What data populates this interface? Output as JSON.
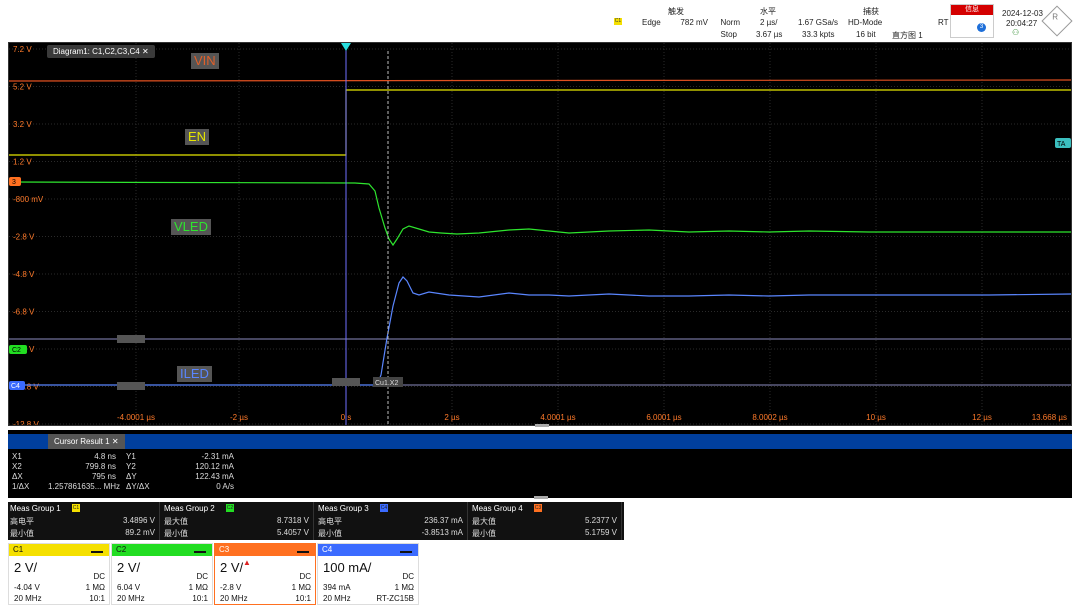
{
  "topbar": {
    "trigger": {
      "title": "触发",
      "chip": "C1",
      "type": "Edge",
      "level": "782 mV",
      "mode": "Norm",
      "state": "Stop"
    },
    "horizontal": {
      "title": "水平",
      "scale": "2 µs/",
      "position": "3.67 µs"
    },
    "acquisition": {
      "title": "捕获",
      "rate": "1.67 GSa/s",
      "points": "33.3 kpts",
      "mode": "HD-Mode",
      "bits": "16 bit",
      "histogram": "直方图 1",
      "rt": "RT"
    },
    "message": {
      "label": "信息",
      "count": "3"
    },
    "date": "2024-12-03",
    "time": "20:04:27"
  },
  "diagram": {
    "tab_label": "Diagram1: C1,C2,C3,C4",
    "labels": {
      "vin": "VIN",
      "en": "EN",
      "vled": "VLED",
      "iled": "ILED"
    },
    "y_ticks": [
      "7.2 V",
      "5.2 V",
      "3.2 V",
      "1.2 V",
      "-800 mV",
      "-2.8 V",
      "-4.8 V",
      "-6.8 V",
      "-8.8 V",
      "-10.8 V",
      "-12.8 V"
    ],
    "x_ticks": [
      "-4.0001 µs",
      "-2 µs",
      "0 s",
      "2 µs",
      "4.0001 µs",
      "6.0001 µs",
      "8.0002 µs",
      "10 µs",
      "12 µs",
      "13.668 µs"
    ],
    "marker_labels": {
      "c3": "3",
      "c2": "C2",
      "c4": "C4",
      "trigger": "TA",
      "cursor": "Cu1.X2"
    },
    "colors": {
      "c1": "#e6e600",
      "c2": "#22dd22",
      "c3": "#ff7020",
      "c4": "#3b6bff"
    }
  },
  "cursor": {
    "tab_label": "Cursor Result 1",
    "rows": [
      {
        "k1": "X1",
        "v1": "4.8 ns",
        "k2": "Y1",
        "v2": "-2.31 mA"
      },
      {
        "k1": "X2",
        "v1": "799.8 ns",
        "k2": "Y2",
        "v2": "120.12 mA"
      },
      {
        "k1": "ΔX",
        "v1": "795 ns",
        "k2": "ΔY",
        "v2": "122.43 mA"
      },
      {
        "k1": "1/ΔX",
        "v1": "1.257861635... MHz",
        "k2": "ΔY/ΔX",
        "v2": "0 A/s"
      }
    ]
  },
  "measurements": [
    {
      "title": "Meas Group 1",
      "chip": "C1",
      "color": "#f5e000",
      "r1": "高电平",
      "v1": "3.4896 V",
      "r2": "最小值",
      "v2": "89.2 mV"
    },
    {
      "title": "Meas Group 2",
      "chip": "C2",
      "color": "#22dd22",
      "r1": "最大值",
      "v1": "8.7318 V",
      "r2": "最小值",
      "v2": "5.4057 V"
    },
    {
      "title": "Meas Group 3",
      "chip": "C4",
      "color": "#3b6bff",
      "r1": "高电平",
      "v1": "236.37 mA",
      "r2": "最小值",
      "v2": "-3.8513 mA"
    },
    {
      "title": "Meas Group 4",
      "chip": "C3",
      "color": "#ff7020",
      "r1": "最大值",
      "v1": "5.2377 V",
      "r2": "最小值",
      "v2": "5.1759 V"
    }
  ],
  "channels": [
    {
      "name": "C1",
      "color": "#f5e000",
      "scale": "2 V/",
      "coupling": "DC",
      "offset": "-4.04 V",
      "impedance": "1 MΩ",
      "bw": "20 MHz",
      "ratio": "10:1"
    },
    {
      "name": "C2",
      "color": "#22dd22",
      "scale": "2 V/",
      "coupling": "DC",
      "offset": "6.04 V",
      "impedance": "1 MΩ",
      "bw": "20 MHz",
      "ratio": "10:1"
    },
    {
      "name": "C3",
      "color": "#ff7020",
      "scale": "2 V/",
      "coupling": "DC",
      "offset": "-2.8 V",
      "impedance": "1 MΩ",
      "bw": "20 MHz",
      "ratio": "10:1"
    },
    {
      "name": "C4",
      "color": "#3b6bff",
      "scale": "100 mA/",
      "coupling": "DC",
      "offset": "394 mA",
      "impedance": "1 MΩ",
      "bw": "20 MHz",
      "ratio": "RT-ZC15B"
    }
  ]
}
